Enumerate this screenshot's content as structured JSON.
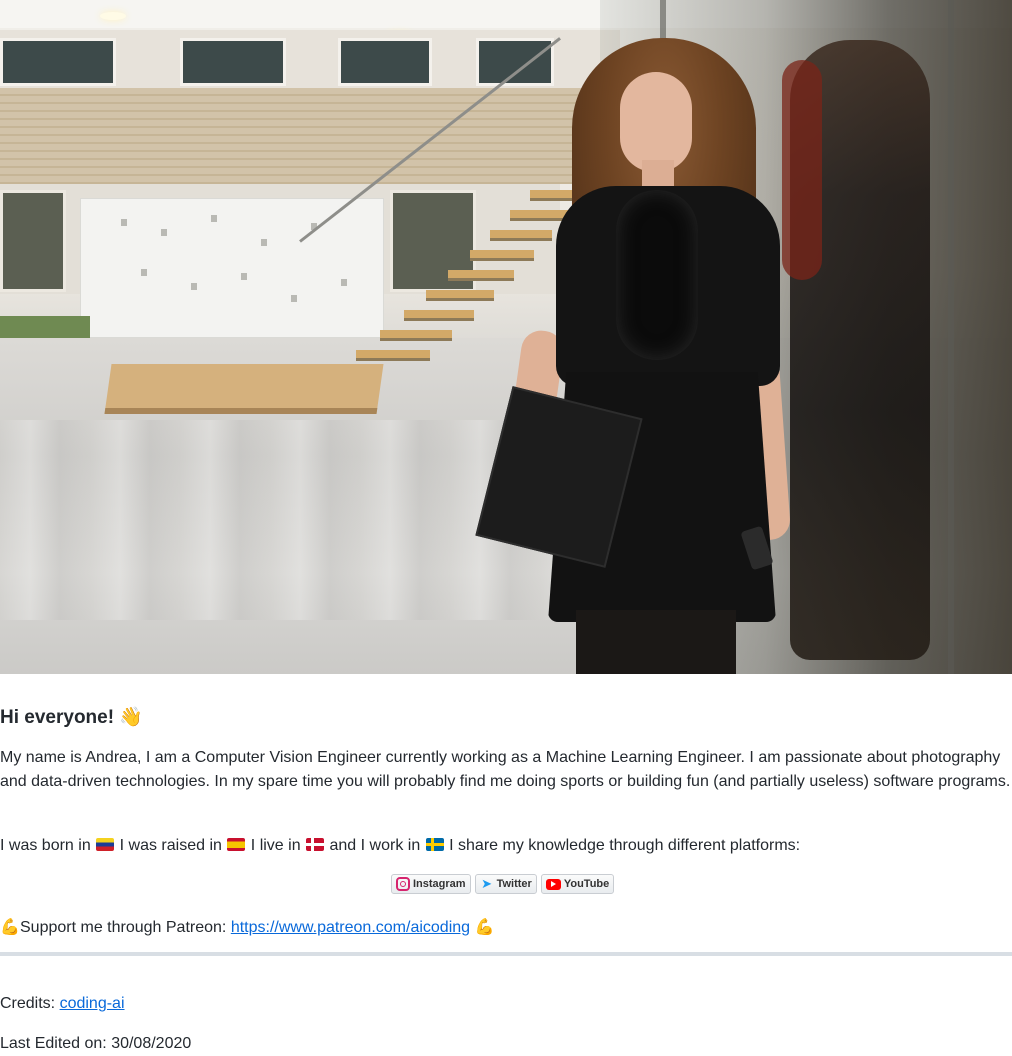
{
  "hero": {
    "icon": "profile-photo"
  },
  "greeting": {
    "text": "Hi everyone!",
    "emoji": "👋"
  },
  "bio": {
    "text": "My name is Andrea, I am a Computer Vision Engineer currently working as a Machine Learning Engineer. I am passionate about photography and data-driven technologies. In my spare time you will probably find me doing sports or building fun (and partially useless) software programs."
  },
  "origin": {
    "born": "I was born in",
    "raised": "I was raised in",
    "live": "I live in",
    "work": "and I work in",
    "share": "I share my knowledge through different platforms:",
    "flags": [
      "venezuela-flag",
      "spain-flag",
      "denmark-flag",
      "sweden-flag"
    ]
  },
  "badges": {
    "instagram": "Instagram",
    "twitter": "Twitter",
    "youtube": "YouTube"
  },
  "patreon": {
    "label": "Support me through Patreon:",
    "url": "https://www.patreon.com/aicoding",
    "emoji": "💪"
  },
  "credits": {
    "label": "Credits:",
    "link": "coding-ai"
  },
  "edited": {
    "text": "Last Edited on: 30/08/2020"
  },
  "colors": {
    "link": "#0969da",
    "divider": "#d8dee4",
    "text": "#24292f"
  }
}
